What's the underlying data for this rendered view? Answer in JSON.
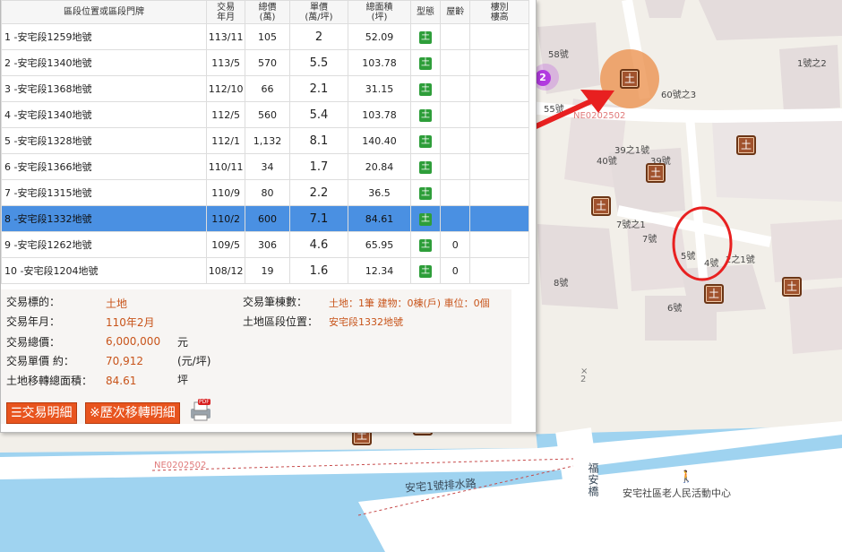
{
  "table": {
    "headers": {
      "location": "區段位置或區段門牌",
      "date_l1": "交易",
      "date_l2": "年月",
      "total_l1": "總價",
      "total_l2": "(萬)",
      "unit_l1": "單價",
      "unit_l2": "(萬/坪)",
      "area_l1": "總面積",
      "area_l2": "(坪)",
      "type": "型態",
      "age": "屋齡",
      "floor_l1": "樓別",
      "floor_l2": "樓高"
    },
    "rows": [
      {
        "loc": "1 -安宅段1259地號",
        "date": "113/11",
        "total": "105",
        "unit": "2",
        "area": "52.09",
        "type": "土",
        "age": ""
      },
      {
        "loc": "2 -安宅段1340地號",
        "date": "113/5",
        "total": "570",
        "unit": "5.5",
        "area": "103.78",
        "type": "土",
        "age": ""
      },
      {
        "loc": "3 -安宅段1368地號",
        "date": "112/10",
        "total": "66",
        "unit": "2.1",
        "area": "31.15",
        "type": "土",
        "age": ""
      },
      {
        "loc": "4 -安宅段1340地號",
        "date": "112/5",
        "total": "560",
        "unit": "5.4",
        "area": "103.78",
        "type": "土",
        "age": ""
      },
      {
        "loc": "5 -安宅段1328地號",
        "date": "112/1",
        "total": "1,132",
        "unit": "8.1",
        "area": "140.40",
        "type": "土",
        "age": ""
      },
      {
        "loc": "6 -安宅段1366地號",
        "date": "110/11",
        "total": "34",
        "unit": "1.7",
        "area": "20.84",
        "type": "土",
        "age": ""
      },
      {
        "loc": "7 -安宅段1315地號",
        "date": "110/9",
        "total": "80",
        "unit": "2.2",
        "area": "36.5",
        "type": "土",
        "age": ""
      },
      {
        "loc": "8 -安宅段1332地號",
        "date": "110/2",
        "total": "600",
        "unit": "7.1",
        "area": "84.61",
        "type": "土",
        "age": ""
      },
      {
        "loc": "9 -安宅段1262地號",
        "date": "109/5",
        "total": "306",
        "unit": "4.6",
        "area": "65.95",
        "type": "土",
        "age": "0"
      },
      {
        "loc": "10 -安宅段1204地號",
        "date": "108/12",
        "total": "19",
        "unit": "1.6",
        "area": "12.34",
        "type": "土",
        "age": "0"
      }
    ]
  },
  "detail": {
    "target_label": "交易標的：",
    "target_value": "土地",
    "ym_label": "交易年月：",
    "ym_value": "110年2月",
    "total_label": "交易總價：",
    "total_value": "6,000,000",
    "total_unit": "元",
    "unit_label": "交易單價 約：",
    "unit_value": "70,912",
    "unit_unit": "(元/坪)",
    "area_label": "土地移轉總面積：",
    "area_value": "84.61",
    "area_unit": "坪",
    "count_label": "交易筆棟數：",
    "count_value": "土地：1筆 建物：0棟(戶) 車位：0個",
    "section_label": "土地區段位置：",
    "section_value": "安宅段1332地號"
  },
  "buttons": {
    "detail": "☰交易明細",
    "history": "※歷次移轉明細",
    "pdf_badge": "PDF"
  },
  "map": {
    "cluster_count": "2",
    "marker_glyph": "土",
    "labels": {
      "l58": "58號",
      "l55": "55號",
      "l60": "60號之3",
      "l1a2": "1號之2",
      "l39a1": "39之1號",
      "l40": "40號",
      "l39": "39號",
      "l7a1": "7號之1",
      "l7": "7號",
      "l5": "5號",
      "l4": "4號",
      "l2a1": "2之1號",
      "l8": "8號",
      "l6": "6號",
      "lx2": "×\n2",
      "ld1": "NE0202502",
      "ld2": "NE0202502",
      "canal": "安宅1號排水路",
      "bridge": "福安橋",
      "center": "安宅社區老人民活動中心"
    }
  },
  "colors": {
    "selected_row": "#4a90e2",
    "tag_green": "#2e9e3a",
    "detail_value": "#c8541a",
    "button_orange": "#e8541e",
    "arrow_red": "#e82020",
    "marker_brown": "#a0522d",
    "cluster_purple": "#b23be0",
    "water": "#9fd3f0"
  }
}
